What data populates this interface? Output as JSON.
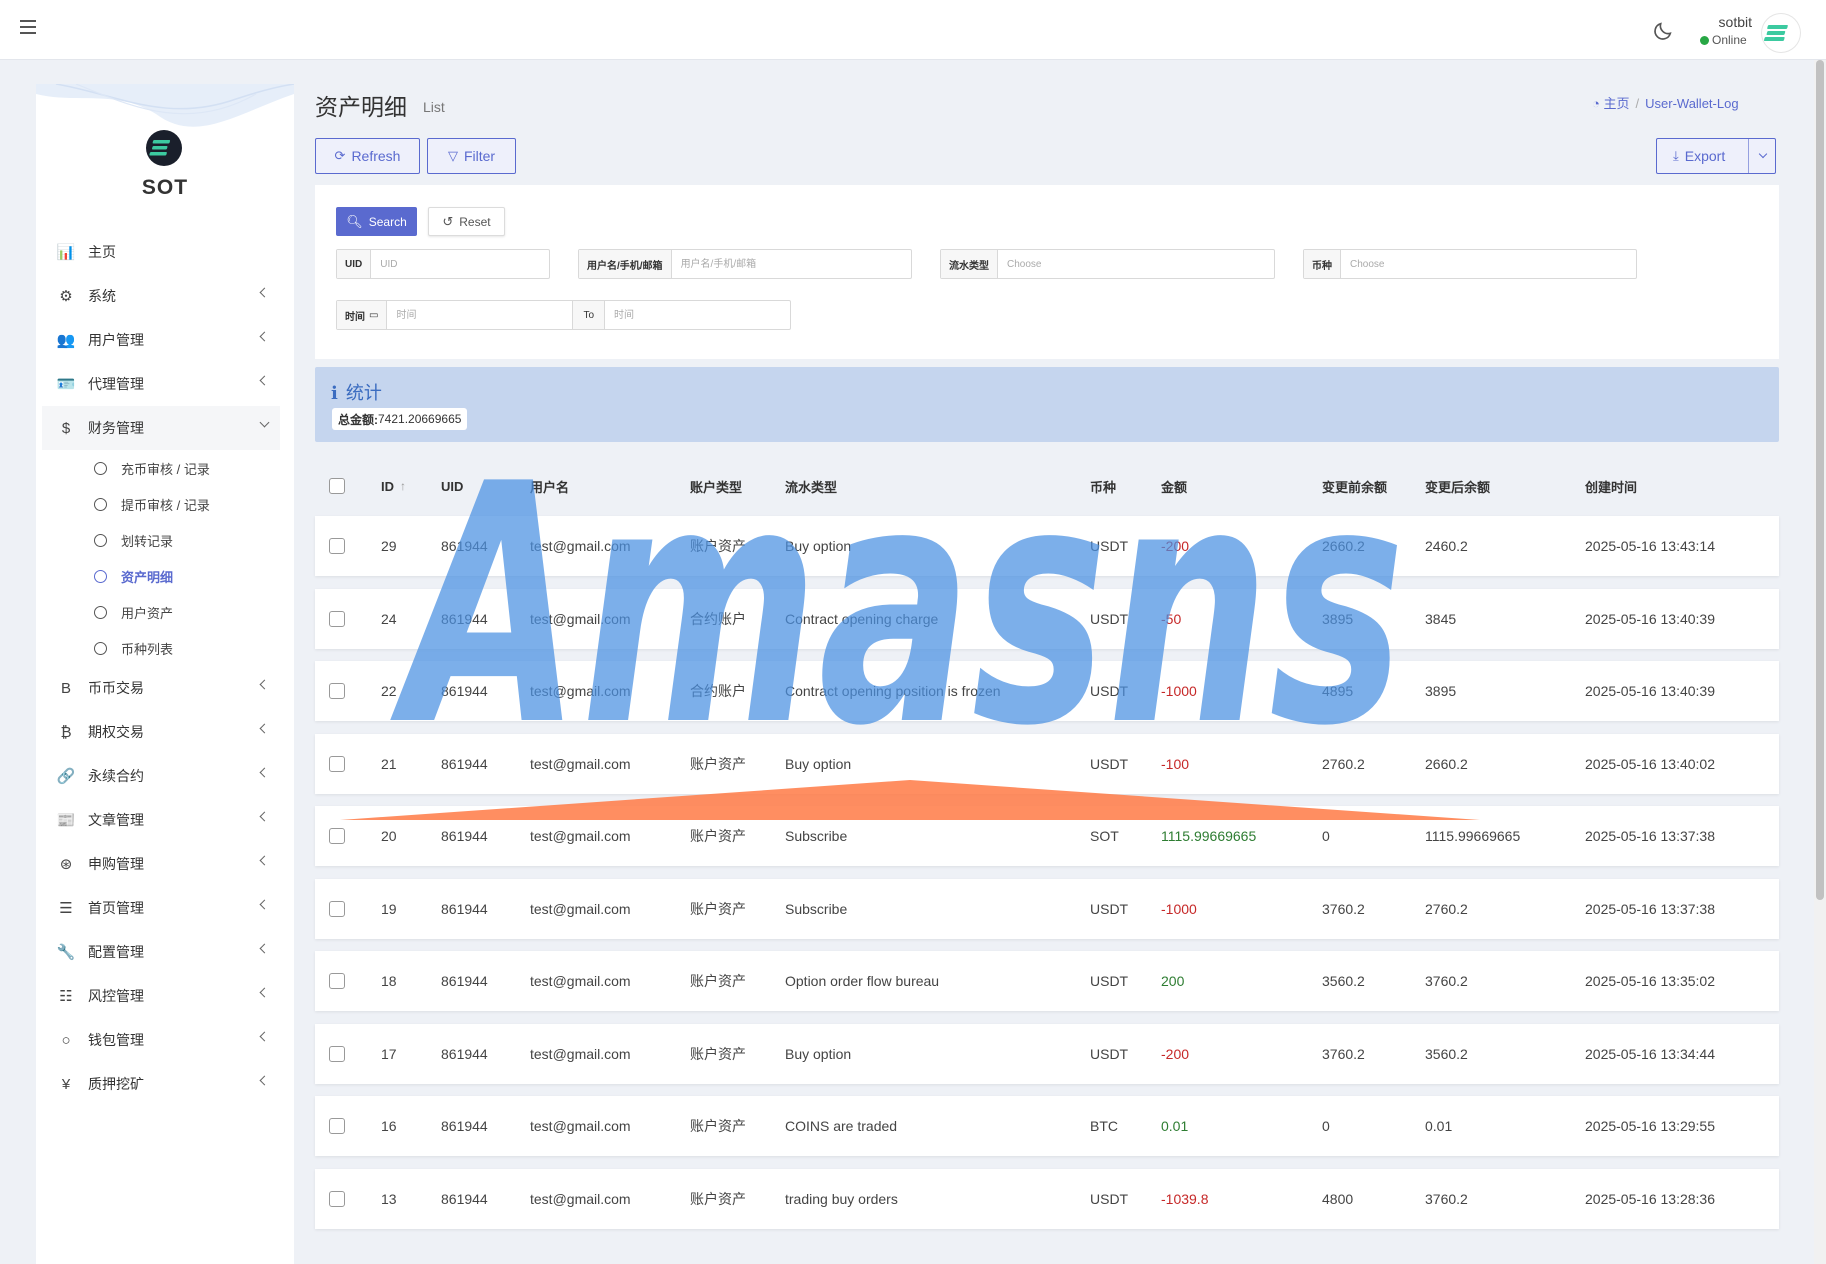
{
  "topbar": {
    "user_name": "sotbit",
    "status": "Online"
  },
  "sidebar": {
    "logo_text": "SOT",
    "menu": [
      {
        "label": "主页",
        "icon": "chart-bar-icon",
        "glyph": "📊",
        "has_children": false
      },
      {
        "label": "系统",
        "icon": "gear-icon",
        "glyph": "⚙",
        "has_children": true
      },
      {
        "label": "用户管理",
        "icon": "users-icon",
        "glyph": "👥",
        "has_children": true
      },
      {
        "label": "代理管理",
        "icon": "id-card-icon",
        "glyph": "🪪",
        "has_children": true
      },
      {
        "label": "财务管理",
        "icon": "dollar-icon",
        "glyph": "$",
        "has_children": true,
        "open": true,
        "children": [
          {
            "label": "充币审核 / 记录"
          },
          {
            "label": "提币审核 / 记录"
          },
          {
            "label": "划转记录"
          },
          {
            "label": "资产明细",
            "active": true
          },
          {
            "label": "用户资产"
          },
          {
            "label": "币种列表"
          }
        ]
      },
      {
        "label": "币币交易",
        "icon": "bitcoin-b-icon",
        "glyph": "B",
        "has_children": true
      },
      {
        "label": "期权交易",
        "icon": "bitcoin-icon",
        "glyph": "₿",
        "has_children": true
      },
      {
        "label": "永续合约",
        "icon": "link-icon",
        "glyph": "🔗",
        "has_children": true
      },
      {
        "label": "文章管理",
        "icon": "newspaper-icon",
        "glyph": "📰",
        "has_children": true
      },
      {
        "label": "申购管理",
        "icon": "life-ring-icon",
        "glyph": "⊛",
        "has_children": true
      },
      {
        "label": "首页管理",
        "icon": "list-icon",
        "glyph": "☰",
        "has_children": true
      },
      {
        "label": "配置管理",
        "icon": "wrench-icon",
        "glyph": "🔧",
        "has_children": true
      },
      {
        "label": "风控管理",
        "icon": "indent-icon",
        "glyph": "☷",
        "has_children": true
      },
      {
        "label": "钱包管理",
        "icon": "circle-icon",
        "glyph": "○",
        "has_children": true
      },
      {
        "label": "质押挖矿",
        "icon": "yen-icon",
        "glyph": "¥",
        "has_children": true
      }
    ]
  },
  "header": {
    "title": "资产明细",
    "subtitle": "List",
    "breadcrumb_home": "主页",
    "breadcrumb_current": "User-Wallet-Log"
  },
  "toolbar": {
    "refresh": "Refresh",
    "filter": "Filter",
    "export": "Export"
  },
  "filter": {
    "search": "Search",
    "reset": "Reset",
    "uid_label": "UID",
    "uid_placeholder": "UID",
    "user_label": "用户名/手机/邮箱",
    "user_placeholder": "用户名/手机/邮箱",
    "type_label": "流水类型",
    "type_placeholder": "Choose",
    "coin_label": "币种",
    "coin_placeholder": "Choose",
    "time_label": "时间",
    "time_placeholder": "时间",
    "to_label": "To",
    "to_placeholder": "时间"
  },
  "stats": {
    "title": "统计",
    "total_label": "总金额:",
    "total_value": "7421.20669665"
  },
  "table": {
    "columns": [
      "ID",
      "UID",
      "用户名",
      "账户类型",
      "流水类型",
      "币种",
      "金额",
      "变更前余额",
      "变更后余额",
      "创建时间"
    ],
    "rows": [
      {
        "id": "29",
        "uid": "861944",
        "user": "test@gmail.com",
        "account": "账户资产",
        "type": "Buy option",
        "coin": "USDT",
        "amount": "-200",
        "sign": "neg",
        "before": "2660.2",
        "after": "2460.2",
        "time": "2025-05-16 13:43:14"
      },
      {
        "id": "24",
        "uid": "861944",
        "user": "test@gmail.com",
        "account": "合约账户",
        "type": "Contract opening charge",
        "coin": "USDT",
        "amount": "-50",
        "sign": "neg",
        "before": "3895",
        "after": "3845",
        "time": "2025-05-16 13:40:39"
      },
      {
        "id": "22",
        "uid": "861944",
        "user": "test@gmail.com",
        "account": "合约账户",
        "type": "Contract opening position is frozen",
        "coin": "USDT",
        "amount": "-1000",
        "sign": "neg",
        "before": "4895",
        "after": "3895",
        "time": "2025-05-16 13:40:39"
      },
      {
        "id": "21",
        "uid": "861944",
        "user": "test@gmail.com",
        "account": "账户资产",
        "type": "Buy option",
        "coin": "USDT",
        "amount": "-100",
        "sign": "neg",
        "before": "2760.2",
        "after": "2660.2",
        "time": "2025-05-16 13:40:02"
      },
      {
        "id": "20",
        "uid": "861944",
        "user": "test@gmail.com",
        "account": "账户资产",
        "type": "Subscribe",
        "coin": "SOT",
        "amount": "1115.99669665",
        "sign": "pos",
        "before": "0",
        "after": "1115.99669665",
        "time": "2025-05-16 13:37:38"
      },
      {
        "id": "19",
        "uid": "861944",
        "user": "test@gmail.com",
        "account": "账户资产",
        "type": "Subscribe",
        "coin": "USDT",
        "amount": "-1000",
        "sign": "neg",
        "before": "3760.2",
        "after": "2760.2",
        "time": "2025-05-16 13:37:38"
      },
      {
        "id": "18",
        "uid": "861944",
        "user": "test@gmail.com",
        "account": "账户资产",
        "type": "Option order flow bureau",
        "coin": "USDT",
        "amount": "200",
        "sign": "pos",
        "before": "3560.2",
        "after": "3760.2",
        "time": "2025-05-16 13:35:02"
      },
      {
        "id": "17",
        "uid": "861944",
        "user": "test@gmail.com",
        "account": "账户资产",
        "type": "Buy option",
        "coin": "USDT",
        "amount": "-200",
        "sign": "neg",
        "before": "3760.2",
        "after": "3560.2",
        "time": "2025-05-16 13:34:44"
      },
      {
        "id": "16",
        "uid": "861944",
        "user": "test@gmail.com",
        "account": "账户资产",
        "type": "COINS are traded",
        "coin": "BTC",
        "amount": "0.01",
        "sign": "pos",
        "before": "0",
        "after": "0.01",
        "time": "2025-05-16 13:29:55"
      },
      {
        "id": "13",
        "uid": "861944",
        "user": "test@gmail.com",
        "account": "账户资产",
        "type": "trading buy orders",
        "coin": "USDT",
        "amount": "-1039.8",
        "sign": "neg",
        "before": "4800",
        "after": "3760.2",
        "time": "2025-05-16 13:28:36"
      }
    ]
  },
  "watermark": {
    "text": "Amasns"
  }
}
